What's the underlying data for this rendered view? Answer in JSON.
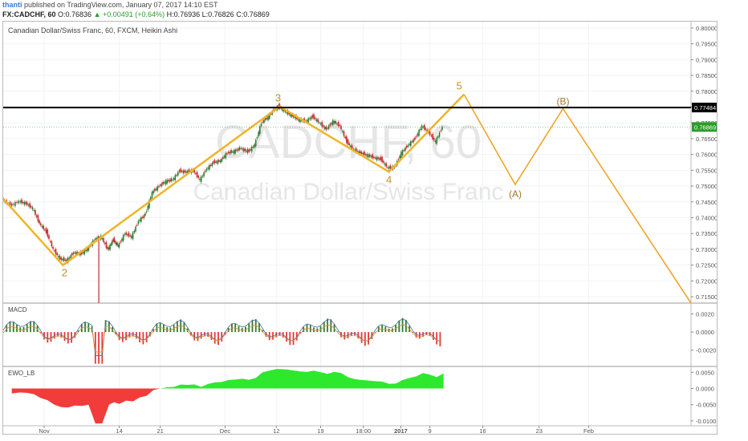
{
  "header": {
    "user": "thanti",
    "published": "published on TradingView.com, January 07, 2017 14:10 EST",
    "symbol": "FX:CADCHF, 60",
    "o": "O:0.76836",
    "change": "▲ +0.00491 (+0.64%)",
    "h": "H:0.76936",
    "l": "L:0.76826",
    "c": "C:0.76869"
  },
  "chart_data": {
    "type": "line",
    "title": "Canadian Dollar/Swiss Franc, 60, FXCM, Heikin Ashi",
    "watermark_symbol": "CADCHF, 60",
    "watermark_name": "Canadian Dollar/Swiss Franc",
    "x_ticks": [
      "Nov",
      "14",
      "21",
      "Dec",
      "12",
      "19",
      "18:00",
      "2017",
      "9",
      "16",
      "23",
      "Feb"
    ],
    "y_ticks": [
      "0.80000",
      "0.79500",
      "0.79000",
      "0.78500",
      "0.78000",
      "0.77500",
      "0.77000",
      "0.76500",
      "0.76000",
      "0.75500",
      "0.75000",
      "0.74500",
      "0.74000",
      "0.73500",
      "0.73000",
      "0.72500",
      "0.72000",
      "0.71500"
    ],
    "ylim": [
      0.713,
      0.802
    ],
    "horizontal_line": {
      "value": 0.77484,
      "label": "0.77484",
      "color": "#000000"
    },
    "last_price": {
      "value": 0.76869,
      "label": "0.76869",
      "color": "#2a9d2a"
    },
    "price_series": [
      {
        "x": 0,
        "y": 0.746
      },
      {
        "x": 5,
        "y": 0.7438
      },
      {
        "x": 10,
        "y": 0.7452
      },
      {
        "x": 14,
        "y": 0.7445
      },
      {
        "x": 18,
        "y": 0.743
      },
      {
        "x": 22,
        "y": 0.7382
      },
      {
        "x": 26,
        "y": 0.7355
      },
      {
        "x": 30,
        "y": 0.73
      },
      {
        "x": 34,
        "y": 0.727
      },
      {
        "x": 38,
        "y": 0.7265
      },
      {
        "x": 42,
        "y": 0.729
      },
      {
        "x": 46,
        "y": 0.7285
      },
      {
        "x": 50,
        "y": 0.73
      },
      {
        "x": 54,
        "y": 0.733
      },
      {
        "x": 58,
        "y": 0.734
      },
      {
        "x": 62,
        "y": 0.73
      },
      {
        "x": 65,
        "y": 0.733
      },
      {
        "x": 68,
        "y": 0.731
      },
      {
        "x": 72,
        "y": 0.735
      },
      {
        "x": 76,
        "y": 0.734
      },
      {
        "x": 80,
        "y": 0.739
      },
      {
        "x": 84,
        "y": 0.741
      },
      {
        "x": 88,
        "y": 0.748
      },
      {
        "x": 92,
        "y": 0.75
      },
      {
        "x": 96,
        "y": 0.7515
      },
      {
        "x": 100,
        "y": 0.752
      },
      {
        "x": 104,
        "y": 0.7548
      },
      {
        "x": 108,
        "y": 0.7545
      },
      {
        "x": 112,
        "y": 0.755
      },
      {
        "x": 116,
        "y": 0.752
      },
      {
        "x": 120,
        "y": 0.7555
      },
      {
        "x": 124,
        "y": 0.7575
      },
      {
        "x": 128,
        "y": 0.758
      },
      {
        "x": 132,
        "y": 0.7605
      },
      {
        "x": 136,
        "y": 0.761
      },
      {
        "x": 140,
        "y": 0.762
      },
      {
        "x": 144,
        "y": 0.7608
      },
      {
        "x": 148,
        "y": 0.763
      },
      {
        "x": 152,
        "y": 0.77
      },
      {
        "x": 156,
        "y": 0.772
      },
      {
        "x": 160,
        "y": 0.7745
      },
      {
        "x": 162,
        "y": 0.7752
      },
      {
        "x": 166,
        "y": 0.7735
      },
      {
        "x": 170,
        "y": 0.7722
      },
      {
        "x": 174,
        "y": 0.771
      },
      {
        "x": 178,
        "y": 0.7705
      },
      {
        "x": 182,
        "y": 0.772
      },
      {
        "x": 186,
        "y": 0.77
      },
      {
        "x": 190,
        "y": 0.768
      },
      {
        "x": 194,
        "y": 0.7705
      },
      {
        "x": 198,
        "y": 0.769
      },
      {
        "x": 202,
        "y": 0.764
      },
      {
        "x": 206,
        "y": 0.7615
      },
      {
        "x": 210,
        "y": 0.7605
      },
      {
        "x": 214,
        "y": 0.7598
      },
      {
        "x": 218,
        "y": 0.759
      },
      {
        "x": 222,
        "y": 0.7585
      },
      {
        "x": 226,
        "y": 0.7558
      },
      {
        "x": 230,
        "y": 0.756
      },
      {
        "x": 234,
        "y": 0.7605
      },
      {
        "x": 238,
        "y": 0.763
      },
      {
        "x": 242,
        "y": 0.765
      },
      {
        "x": 246,
        "y": 0.769
      },
      {
        "x": 250,
        "y": 0.767
      },
      {
        "x": 254,
        "y": 0.764
      },
      {
        "x": 258,
        "y": 0.7687
      }
    ],
    "wave_count": {
      "labels": [
        "2",
        "3",
        "4",
        "5"
      ],
      "points": [
        {
          "x": 0,
          "y": 0.746
        },
        {
          "x": 35,
          "y": 0.725,
          "label": "2"
        },
        {
          "x": 162,
          "y": 0.7752,
          "label": "3"
        },
        {
          "x": 226,
          "y": 0.7545,
          "label": "4"
        },
        {
          "x": 270,
          "y": 0.779,
          "label": "5"
        }
      ],
      "color": "#f0b429"
    },
    "projection": {
      "labels": [
        "(A)",
        "(B)"
      ],
      "points": [
        {
          "x": 270,
          "y": 0.779
        },
        {
          "x": 300,
          "y": 0.7505,
          "label": "(A)"
        },
        {
          "x": 328,
          "y": 0.7745,
          "label": "(B)"
        },
        {
          "x": 403,
          "y": 0.713
        }
      ],
      "color": "#f0a529"
    },
    "macd": {
      "label": "MACD",
      "y_ticks": [
        "0.0020",
        "0.0000",
        "-0.0020"
      ],
      "ylim": [
        -0.0038,
        0.0032
      ]
    },
    "ewo": {
      "label": "EWO_LB",
      "y_ticks": [
        "0.0050",
        "0.0000",
        "-0.0050",
        "-0.0100"
      ],
      "ylim": [
        -0.0115,
        0.0068
      ]
    },
    "x_domain": [
      0,
      403
    ],
    "x_tick_positions": [
      24,
      68,
      92,
      130,
      160,
      186,
      211,
      233,
      250,
      281,
      314,
      343
    ]
  }
}
